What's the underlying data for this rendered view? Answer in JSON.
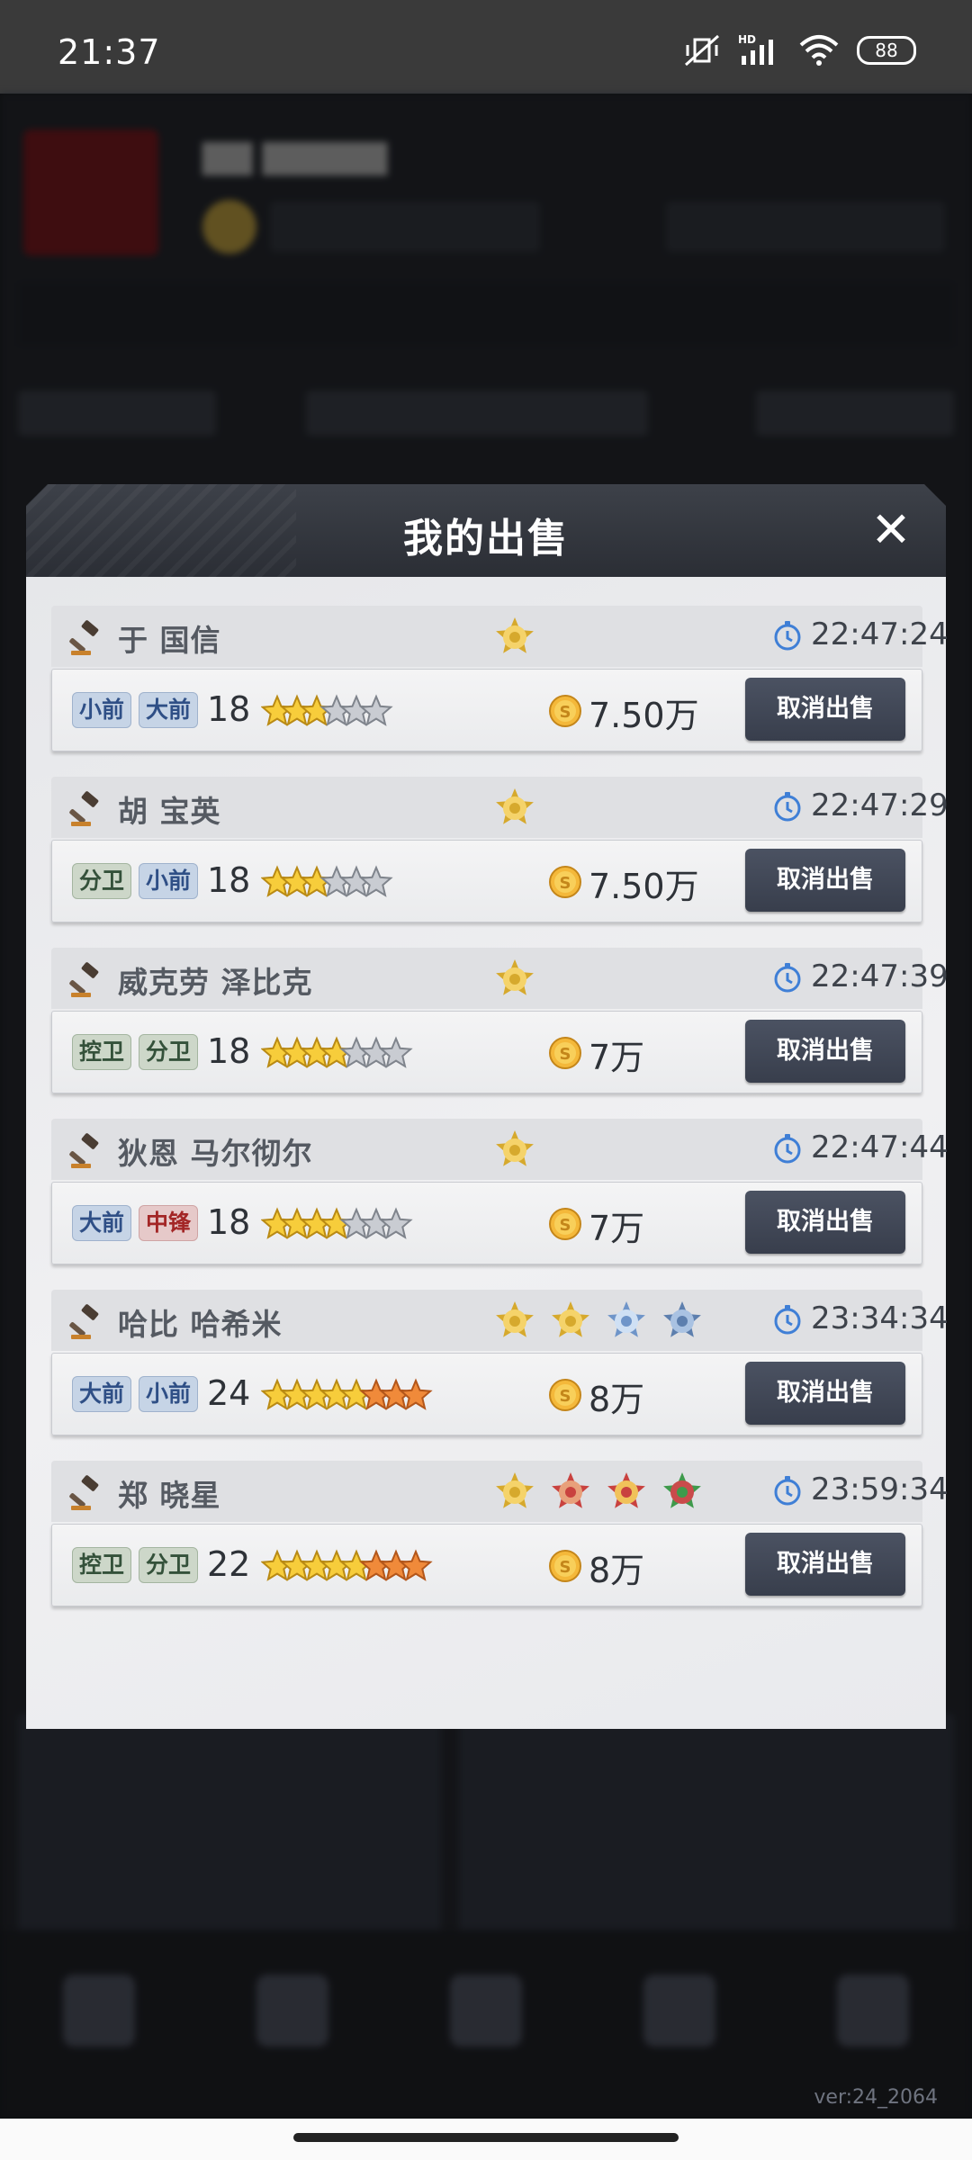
{
  "status_bar": {
    "time": "21:37",
    "network": "HD",
    "battery": "88"
  },
  "background": {
    "version": "ver:24_2064"
  },
  "modal": {
    "title": "我的出售",
    "cancel_label": "取消出售",
    "items": [
      {
        "name": "于 国信",
        "time": "22:47:24",
        "positions": [
          {
            "label": "小前",
            "color": "blue"
          },
          {
            "label": "大前",
            "color": "blue"
          }
        ],
        "age": "18",
        "stars_gold": 3,
        "stars_orange": 0,
        "stars_grey": 3,
        "price": "7.50万",
        "badges": [
          "gold"
        ]
      },
      {
        "name": "胡 宝英",
        "time": "22:47:29",
        "positions": [
          {
            "label": "分卫",
            "color": "green"
          },
          {
            "label": "小前",
            "color": "blue"
          }
        ],
        "age": "18",
        "stars_gold": 3,
        "stars_orange": 0,
        "stars_grey": 3,
        "price": "7.50万",
        "badges": [
          "gold"
        ]
      },
      {
        "name": "威克劳 泽比克",
        "time": "22:47:39",
        "positions": [
          {
            "label": "控卫",
            "color": "green"
          },
          {
            "label": "分卫",
            "color": "green"
          }
        ],
        "age": "18",
        "stars_gold": 4,
        "stars_orange": 0,
        "stars_grey": 3,
        "price": "7万",
        "badges": [
          "gold"
        ]
      },
      {
        "name": "狄恩 马尔彻尔",
        "time": "22:47:44",
        "positions": [
          {
            "label": "大前",
            "color": "blue"
          },
          {
            "label": "中锋",
            "color": "red"
          }
        ],
        "age": "18",
        "stars_gold": 4,
        "stars_orange": 0,
        "stars_grey": 3,
        "price": "7万",
        "badges": [
          "gold"
        ]
      },
      {
        "name": "哈比 哈希米",
        "time": "23:34:34",
        "positions": [
          {
            "label": "大前",
            "color": "blue"
          },
          {
            "label": "小前",
            "color": "blue"
          }
        ],
        "age": "24",
        "stars_gold": 5,
        "stars_orange": 3,
        "stars_grey": 0,
        "price": "8万",
        "badges": [
          "gold",
          "gold-bolt",
          "blue",
          "blue-dark"
        ]
      },
      {
        "name": "郑 晓星",
        "time": "23:59:34",
        "positions": [
          {
            "label": "控卫",
            "color": "green"
          },
          {
            "label": "分卫",
            "color": "green"
          }
        ],
        "age": "22",
        "stars_gold": 5,
        "stars_orange": 3,
        "stars_grey": 0,
        "price": "8万",
        "badges": [
          "gold",
          "red",
          "red-3",
          "green"
        ]
      }
    ]
  }
}
